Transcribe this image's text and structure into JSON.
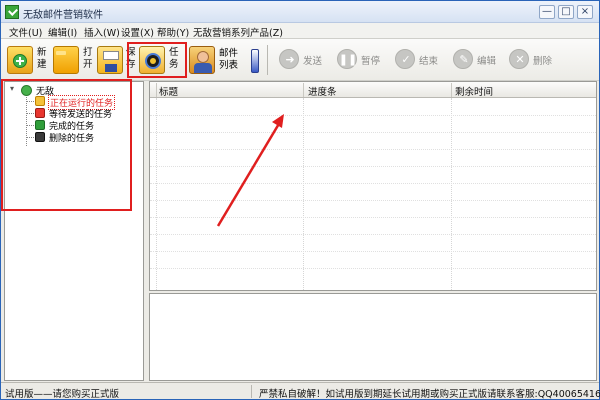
{
  "window": {
    "title": "无敌邮件营销软件",
    "controls": {
      "minimize": "—",
      "maximize": "□",
      "close": "×"
    }
  },
  "menu": [
    "文件(U)",
    "编辑(I)",
    "插入(W)",
    "设置(X)",
    "帮助(Y)",
    "无敌营销系列产品(Z)"
  ],
  "toolbar": {
    "new_label": "新建",
    "open_label": "打开",
    "save_label": "保存",
    "task_label": "任务",
    "mail_list_label": "邮件列表",
    "send_label": "发送",
    "pause_label": "暂停",
    "end_label": "结束",
    "edit_label": "编辑",
    "delete_label": "删除"
  },
  "tree": {
    "root": "无敌",
    "items": [
      "正在运行的任务",
      "等待发送的任务",
      "完成的任务",
      "删除的任务"
    ]
  },
  "list": {
    "columns": [
      "标题",
      "进度条",
      "剩余时间"
    ]
  },
  "status": {
    "left": "试用版——请您购买正式版",
    "right": "严禁私自破解！如试用版到期延长试用期或购买正式版请联系客服:QQ4006541688"
  },
  "colors": {
    "accent": "#2a64b8",
    "annotation": "#e01f1f",
    "selected_text": "#e01f1f"
  }
}
